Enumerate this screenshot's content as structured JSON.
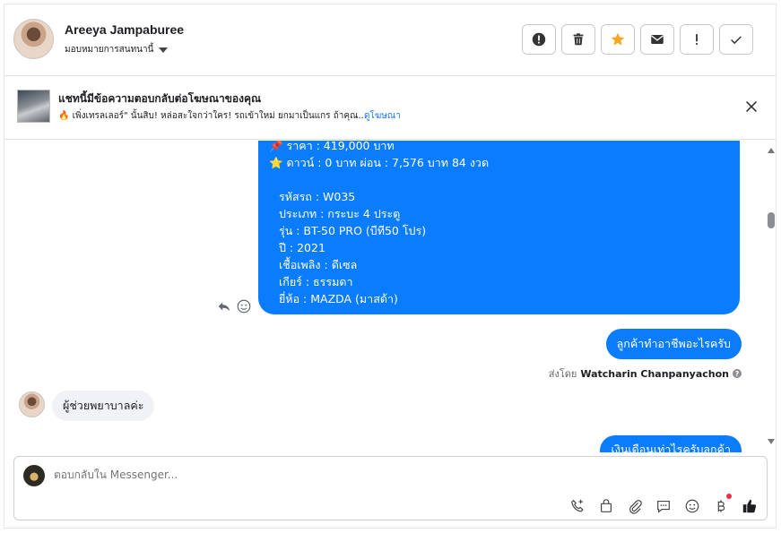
{
  "header": {
    "contact_name": "Areeya Jampaburee",
    "assign_label": "มอบหมายการสนทนานี้",
    "actions": [
      {
        "name": "mark-spam-button",
        "icon": "exclamation-circle-icon"
      },
      {
        "name": "delete-button",
        "icon": "trash-icon"
      },
      {
        "name": "star-button",
        "icon": "star-icon",
        "color": "#f5a623"
      },
      {
        "name": "mark-unread-button",
        "icon": "envelope-icon"
      },
      {
        "name": "follow-up-button",
        "icon": "exclamation-icon"
      },
      {
        "name": "mark-done-button",
        "icon": "check-icon"
      }
    ]
  },
  "ad": {
    "title": "แชทนี้มีข้อความตอบกลับต่อโฆษณาของคุณ",
    "description": "🔥 เพิ่งเทรลเลอร์\" นั้นสิบ! หล่อสะใจกว่าใคร! รถเข้าใหม่ ยกมาเป็นแกร ถ้าคุณ...",
    "link": "ดูโฆษณา"
  },
  "messages": {
    "listing": {
      "lines": [
        "📌 ราคา : 419,000 บาท",
        "⭐ ดาวน์ : 0 บาท ผ่อน : 7,576 บาท 84 งวด",
        "",
        "รหัสรถ : W035",
        "ประเภท : กระบะ 4 ประตู",
        "รุ่น : BT-50 PRO (บีที50 โปร)",
        "ปี : 2021",
        "เชื้อเพลิง : ดีเซล",
        "เกียร์ : ธรรมดา",
        "ยี่ห้อ : MAZDA (มาสด้า)"
      ]
    },
    "outgoing_1": "ลูกค้าทำอาชีพอะไรครับ",
    "sent_by_prefix": "ส่งโดย",
    "sent_by_name": "Watcharin Chanpanyachon",
    "incoming_1": "ผู้ช่วยพยาบาลค่ะ",
    "outgoing_2_partial": "เงินเดือนเท่าไรครับลูกค้า"
  },
  "composer": {
    "placeholder": "ตอบกลับใน Messenger..."
  },
  "colors": {
    "accent": "#0a7cff",
    "link": "#1877f2",
    "star": "#f5a623"
  }
}
